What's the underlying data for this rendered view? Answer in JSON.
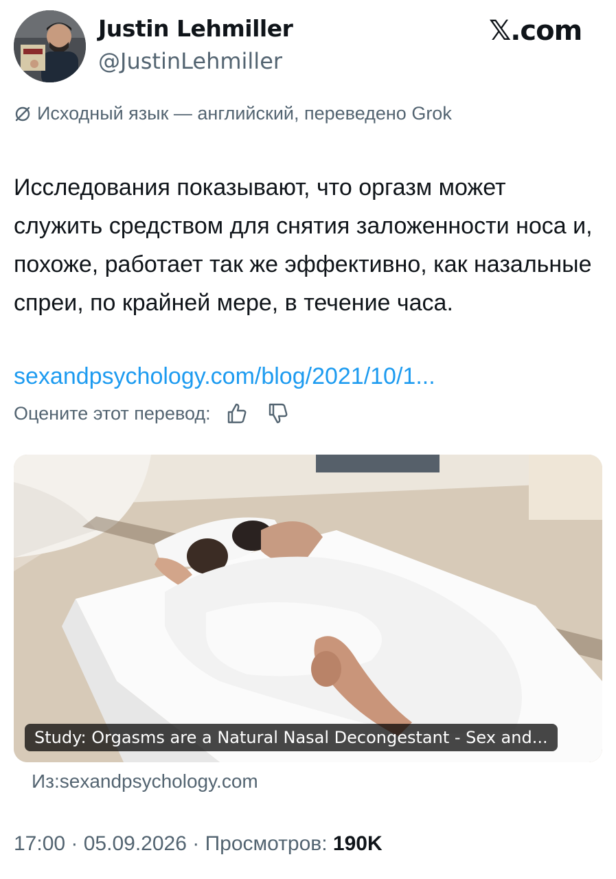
{
  "author": {
    "display_name": "Justin Lehmiller",
    "handle": "@JustinLehmiller"
  },
  "brand": {
    "label": "𝕏.com"
  },
  "translation_note": "Исходный язык — английский, переведено Grok",
  "tweet": {
    "text": "Исследования показывают, что оргазм может служить средством для снятия заложенности носа и, похоже, работает так же эффективно, как назальные спреи, по крайней мере, в течение часа.",
    "link": "sexandpsychology.com/blog/2021/10/1..."
  },
  "rating": {
    "label": "Оцените этот перевод:"
  },
  "card": {
    "caption": "Study: Orgasms are a Natural Nasal Decongestant - Sex and...",
    "source": "Из:sexandpsychology.com"
  },
  "meta": {
    "time": "17:00",
    "date": "05.09.2026",
    "views_label": "Просмотров:",
    "views_count": "190K"
  },
  "colors": {
    "link": "#1d9bf0",
    "secondary": "#536471",
    "text": "#0f1419"
  },
  "icons": [
    "avatar-photo",
    "translate-slash-icon",
    "thumbs-up-icon",
    "thumbs-down-icon",
    "x-logo-icon"
  ]
}
